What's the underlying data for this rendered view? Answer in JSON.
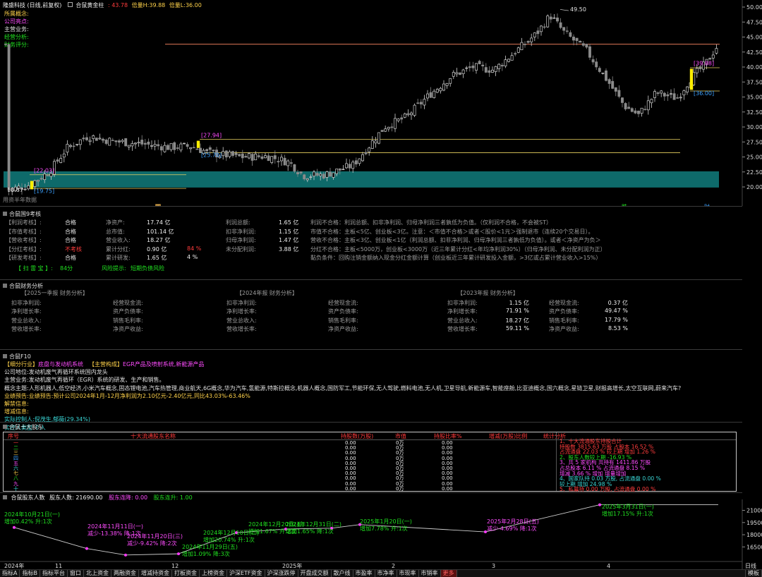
{
  "header": {
    "stock_title": "隆盛科技 (日线,前复权)",
    "indicator_name": "合鼠黄金柱",
    "values": [
      {
        "label": "",
        "value": "43.78",
        "color": "#ff3c3c"
      },
      {
        "label": "倍量H:",
        "value": "39.88",
        "color": "#ffd24a"
      },
      {
        "label": "倍量L:",
        "value": "36.00",
        "color": "#ffd24a"
      }
    ]
  },
  "left_labels": [
    {
      "text": "所属概念:",
      "color": "#ffd24a"
    },
    {
      "text": "公司亮点:",
      "color": "#ff4cff"
    },
    {
      "text": "主营业务:",
      "color": "#e0e0e0"
    },
    {
      "text": "经营分析:",
      "color": "#20e020"
    },
    {
      "text": "财务评分:",
      "color": "#20e020"
    }
  ],
  "price_axis": [
    "50.00",
    "47.50",
    "45.00",
    "42.50",
    "40.00",
    "37.50",
    "35.00",
    "32.50",
    "30.00",
    "27.50",
    "25.00",
    "22.50",
    "20.00"
  ],
  "price_annotations": {
    "high": "49.50",
    "low": "18.87",
    "box_a_top": "[22.03]",
    "box_a_bottom": "[19.75]",
    "box_b_top": "[27.94]",
    "box_b_bottom": "[25.70]",
    "box_c_top": "[39.88]",
    "box_c_bottom": "[36.00]",
    "footnote": "用资半年数据"
  },
  "date_markers": {
    "left": "四",
    "right1": "跌",
    "right2": "财"
  },
  "audit_panel": {
    "title": "合鼠国9考核",
    "rows": [
      {
        "k": "【利润考核】:",
        "s": "合格",
        "sc": "#e0e0e0",
        "m": "净资产:",
        "v": "17.74 亿",
        "m2": "利润总额:",
        "v2": "1.65 亿",
        "note": "利润不合格：利润总额、扣非净利润、归母净利润三者孰低为负值。（仅利润不合格，不会被ST）"
      },
      {
        "k": "【市值考核】:",
        "s": "合格",
        "sc": "#e0e0e0",
        "m": "总市值:",
        "v": "101.14 亿",
        "m2": "扣非净利润:",
        "v2": "1.15 亿",
        "note": "市值不合格：主板<5亿、创业板<3亿。注意：＜市值不合格＞或者＜股价<1元＞强制退市（连续20个交易日）。"
      },
      {
        "k": "【营收考核】:",
        "s": "合格",
        "sc": "#e0e0e0",
        "m": "营业收入:",
        "v": "18.27 亿",
        "m2": "归母净利润:",
        "v2": "1.47 亿",
        "note": "营收不合格：主板<3亿、创业板<1亿（利润总额、扣非净利润、归母净利润三者孰低为负值）。或者＜净资产为负＞"
      },
      {
        "k": "【分红考核】:",
        "s": "不考核",
        "sc": "#ff3c3c",
        "m": "累计分红:",
        "v": "0.90 亿",
        "pct": "84 %",
        "m2": "未分配利润:",
        "v2": "3.88 亿",
        "note": "分红不合格：主板<5000万，创业板<3000万（近三年累计分红<年均净利润30%）（归母净利润、未分配利润为正）"
      },
      {
        "k": "【研发考核】:",
        "s": "合格",
        "sc": "#e0e0e0",
        "m": "累计研发:",
        "v": "1.65 亿",
        "pct": "4 %",
        "m2": "",
        "v2": "",
        "note": "        黏负条件：回购注销金额纳入现金分红金额计算（创业板近三年累计研发投入金额，>3亿或占累计营业收入>15%）"
      }
    ],
    "score_label": "【 扫 雷 宝 】:",
    "score": "84分",
    "risk_label": "风险提示:",
    "risk": "短期负债风险"
  },
  "finance_panel": {
    "title": "合鼠财务分析",
    "cols": [
      {
        "head": "【2025一季报  财务分析】",
        "rows": [
          [
            "扣非净利润:",
            ""
          ],
          [
            "净利增长率:",
            ""
          ],
          [
            "营业总收入:",
            ""
          ],
          [
            "营收增长率:",
            ""
          ]
        ],
        "rows2": [
          [
            "经营现金流:",
            ""
          ],
          [
            "资产负债率:",
            ""
          ],
          [
            "销售毛利率:",
            ""
          ],
          [
            "净资产收益:",
            ""
          ]
        ]
      },
      {
        "head": "【2024年报  财务分析】",
        "rows": [
          [
            "扣非净利润:",
            ""
          ],
          [
            "净利增长率:",
            ""
          ],
          [
            "营业总收入:",
            ""
          ],
          [
            "营收增长率:",
            ""
          ]
        ],
        "rows2": [
          [
            "经营现金流:",
            ""
          ],
          [
            "资产负债率:",
            ""
          ],
          [
            "销售毛利率:",
            ""
          ],
          [
            "净资产收益:",
            ""
          ]
        ]
      },
      {
        "head": "【2023年报  财务分析】",
        "rows": [
          [
            "扣非净利润:",
            "1.15 亿"
          ],
          [
            "净利增长率:",
            "71.91 %"
          ],
          [
            "营业总收入:",
            "18.27 亿"
          ],
          [
            "营收增长率:",
            "59.11 %"
          ]
        ],
        "rows2": [
          [
            "经营现金流:",
            "0.37 亿"
          ],
          [
            "资产负债率:",
            "49.47 %"
          ],
          [
            "销售毛利率:",
            "17.79 %"
          ],
          [
            "净资产收益:",
            "8.53 %"
          ]
        ]
      }
    ]
  },
  "f10_panel": {
    "title": "合鼠F10",
    "industry_label": "【细分行业】",
    "industry": "底盘与发动机系统",
    "composition_label": "【主营构成】",
    "composition": "EGR产品及喷射系统,新能源产品",
    "lines": [
      {
        "k": "公司地位:",
        "v": "发动机废气再循环系统国内龙头",
        "c": "#e0e0e0"
      },
      {
        "k": "主营业务:",
        "v": "发动机废气再循环（EGR）系统的研发、生产和销售。",
        "c": "#e0e0e0"
      },
      {
        "k": "概念主题:",
        "v": "人形机器人,低空经济,小米汽车概念,固态锂电池,汽车热管理,商业航天,6G概念,华为汽车,氢能源,特斯拉概念,机器人概念,国防军工,节能环保,无人驾驶,燃料电池,无人机,卫星导航,新能源车,智能座舱,比亚迪概念,国六概念,星链卫星,财报高增长,太空互联网,蔚来汽车?",
        "c": "#e0e0e0"
      },
      {
        "k": "业绩预告:",
        "v": "业绩预告:预计公司2024年1月-12月净利润为2.10亿元-2.40亿元,同比43.03%-63.46%",
        "c": "#ffd24a"
      },
      {
        "k": "解禁信息:",
        "v": "",
        "c": "#ffd24a"
      },
      {
        "k": "增减信息:",
        "v": "",
        "c": "#ffd24a"
      },
      {
        "k": "实际控制人:",
        "v": "倪茂生,郁薇(29.34%)",
        "c": "#3ad6d6"
      },
      {
        "k": "实控人类型:",
        "v": "个人",
        "c": "#3ad6d6"
      }
    ]
  },
  "top10_panel": {
    "title": "合鼠十大股东",
    "headers": [
      "序号",
      "十大流通股东名称",
      "持股数(万股)",
      "市值",
      "持股比率%",
      "增减(万股)比例",
      "统计分析"
    ],
    "ranks": [
      "一",
      "二",
      "三",
      "四",
      "五",
      "六",
      "七",
      "八",
      "九",
      "十"
    ],
    "zeros": [
      "0.00",
      "0万",
      "0.00"
    ],
    "stats": [
      {
        "t": "1、十大流通股东持股合计",
        "c": "#ff3c3c"
      },
      {
        "t": "持股数 3815.63 万股  占股本 16.52 %",
        "c": "#ff3c3c"
      },
      {
        "t": "占流通盘 22.03 %  较上期 增加 1.26 %",
        "c": "#ff3c3c"
      },
      {
        "t": "2、股东人数较上期 -16.93 %",
        "c": "#20e020"
      },
      {
        "t": "3、共 5 家机构  共持有  1411.86 万股",
        "c": "#ff4cff"
      },
      {
        "t": "占总股本 6.11 % 占流通盘 8.15 %",
        "c": "#ff4cff"
      },
      {
        "t": "增减  3.66 %  增加 增量增加",
        "c": "#ff4cff"
      },
      {
        "t": "4、国家队持 0.03 万股, 占流通盘 0.00 %",
        "c": "#3ad6d6"
      },
      {
        "t": "较上期  增加  24.98 %",
        "c": "#3ad6d6"
      },
      {
        "t": "5、私募持 0.00 万股, 占流通盘 0.00 %",
        "c": "#ff3c3c"
      }
    ]
  },
  "holders_panel": {
    "title": "合鼠股东人数",
    "count_label": "股东人数:",
    "count": "21690.00",
    "fall_label": "股东连降:",
    "fall": "0.00",
    "rise_label": "股东连升:",
    "rise": "1.00",
    "axis": [
      "21000",
      "19500",
      "18000",
      "16500"
    ],
    "chart_data": {
      "type": "line",
      "x": [
        "2024-10-21",
        "2024-11-11",
        "2024-11-20",
        "2024-11-29",
        "2024-12-10",
        "2024-12-20",
        "2024-12-31",
        "2025-01-20",
        "2025-02-28",
        "2025-03-31"
      ],
      "values": [
        18900,
        16300,
        15500,
        15650,
        18250,
        18700,
        18800,
        19250,
        18350,
        21690
      ],
      "ylim": [
        15400,
        22000
      ]
    },
    "labels": [
      {
        "d": "2024年10月21日(一)",
        "c": "增加0.42%  升:1次"
      },
      {
        "d": "2024年11月11日(一)",
        "c": "减少-13.38%  降:1次"
      },
      {
        "d": "2024年11月20日(三)",
        "c": "减少-9.42%  降:2次"
      },
      {
        "d": "2024年11月29日(五)",
        "c": "增加1.09%  降:3次"
      },
      {
        "d": "2024年12月10日(二)",
        "c": "增加20.74%  升:1次"
      },
      {
        "d": "2024年12月20日(五)",
        "c": "增加1.67%  升:2次"
      },
      {
        "d": "2024年12月31日(二)",
        "c": "增加1.65%  降:1次"
      },
      {
        "d": "2025年1月20日(一)",
        "c": "增加7.78%  升:1次"
      },
      {
        "d": "2025年2月28日(五)",
        "c": "减少-4.69%  降:1次"
      },
      {
        "d": "2025年3月31日(一)",
        "c": "增加17.15%  升:1次"
      }
    ],
    "xaxis": [
      "2024年",
      "11",
      "12",
      "2025年",
      "2",
      "3",
      "4"
    ],
    "period": "日线"
  },
  "bottom_tabs": [
    "指标A",
    "指标B",
    "指标平台",
    "窗口",
    "北上资金",
    "两融资金",
    "增减持资金",
    "打板资金",
    "上榜资金",
    "沪深ETF资金",
    "沪深涨跌停",
    "开盘成交额",
    "散户线",
    "市盈率",
    "市净率",
    "市现率",
    "市销率",
    "更多"
  ],
  "bottom_right": "模板"
}
